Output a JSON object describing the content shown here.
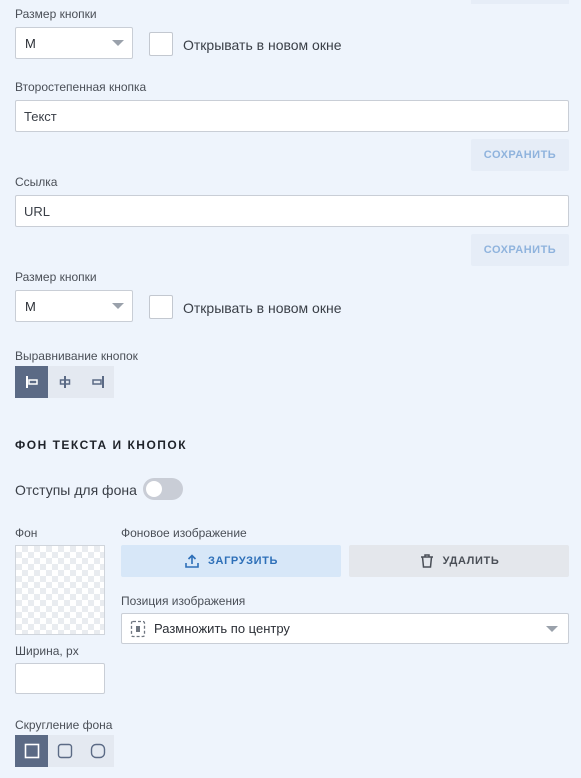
{
  "button_section_1": {
    "size_label": "Размер кнопки",
    "size_value": "M",
    "new_window_label": "Открывать в новом окне"
  },
  "secondary_button": {
    "label": "Второстепенная кнопка",
    "text_value": "Текст",
    "save_label": "СОХРАНИТЬ"
  },
  "link": {
    "label": "Ссылка",
    "url_value": "URL",
    "save_label": "СОХРАНИТЬ"
  },
  "button_section_2": {
    "size_label": "Размер кнопки",
    "size_value": "M",
    "new_window_label": "Открывать в новом окне"
  },
  "alignment": {
    "label": "Выравнивание кнопок",
    "options": [
      "align-left-icon",
      "align-center-icon",
      "align-right-icon"
    ],
    "selected": 0
  },
  "background_section": {
    "title": "ФОН ТЕКСТА И КНОПОК",
    "padding_toggle_label": "Отступы для фона",
    "padding_toggle_on": false,
    "bg_label": "Фон",
    "bg_image_label": "Фоновое изображение",
    "upload_label": "ЗАГРУЗИТЬ",
    "delete_label": "УДАЛИТЬ",
    "position_label": "Позиция изображения",
    "position_value": "Размножить по центру",
    "width_label": "Ширина, px",
    "width_value": "",
    "rounding_label": "Скругление фона",
    "rounding_options": [
      "square-corner-icon",
      "small-rounded-icon",
      "large-rounded-icon"
    ],
    "rounding_selected": 0
  },
  "colors": {
    "accent": "#5b6a85",
    "page_bg": "#eef4fc",
    "save_text": "#8fb3dd",
    "upload_text": "#2d6fb8"
  }
}
